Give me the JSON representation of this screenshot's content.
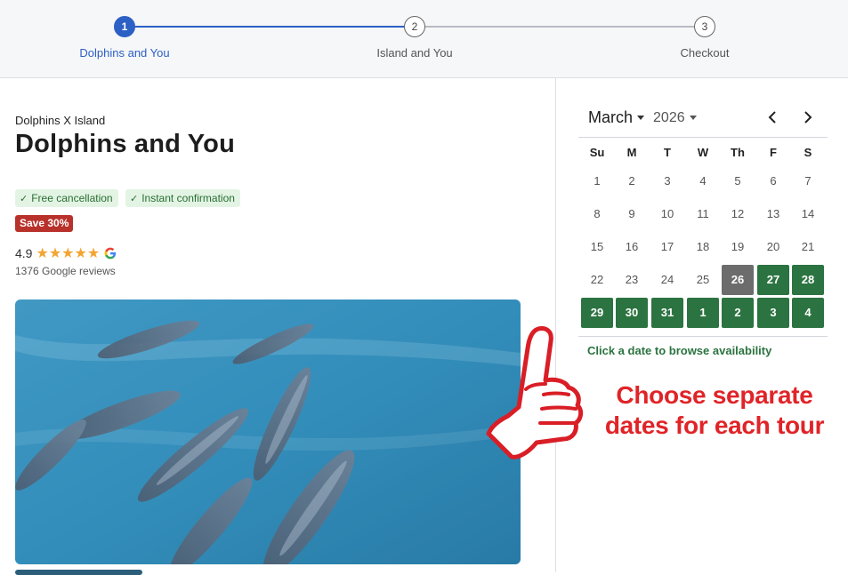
{
  "stepper": {
    "steps": [
      {
        "number": "1",
        "label": "Dolphins and You",
        "state": "active"
      },
      {
        "number": "2",
        "label": "Island and You",
        "state": "inactive"
      },
      {
        "number": "3",
        "label": "Checkout",
        "state": "inactive"
      }
    ]
  },
  "tour": {
    "breadcrumb": "Dolphins X Island",
    "title": "Dolphins and You",
    "tags": [
      "Free cancellation",
      "Instant confirmation"
    ],
    "save_badge": "Save 30%",
    "rating": "4.9",
    "stars": 5,
    "reviews": "1376 Google reviews",
    "photo_icon": "dolphins-photo"
  },
  "calendar": {
    "month": "March",
    "year": "2026",
    "weekdays": [
      "Su",
      "M",
      "T",
      "W",
      "Th",
      "F",
      "S"
    ],
    "weeks": [
      [
        "1",
        "2",
        "3",
        "4",
        "5",
        "6",
        "7"
      ],
      [
        "8",
        "9",
        "10",
        "11",
        "12",
        "13",
        "14"
      ],
      [
        "15",
        "16",
        "17",
        "18",
        "19",
        "20",
        "21"
      ],
      [
        "22",
        "23",
        "24",
        "25",
        "26",
        "27",
        "28"
      ],
      [
        "29",
        "30",
        "31",
        "1",
        "2",
        "3",
        "4"
      ]
    ],
    "selected": "26",
    "hint": "Click a date to browse availability"
  },
  "annotation": {
    "line1": "Choose separate",
    "line2": "dates for each tour"
  },
  "colors": {
    "accent": "#2c60c4",
    "available": "#2b7340",
    "selected": "#6c6c6c",
    "save": "#b8312b",
    "annotation": "#e02428"
  }
}
